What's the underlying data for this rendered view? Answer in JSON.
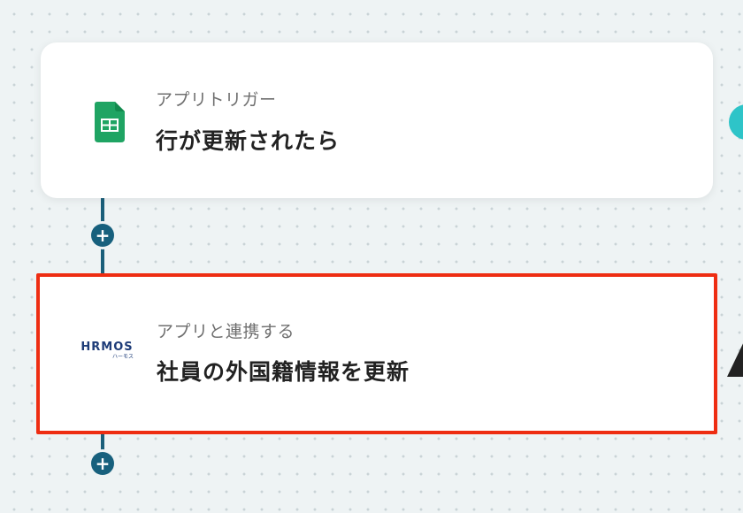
{
  "flow": {
    "trigger": {
      "category": "アプリトリガー",
      "name": "行が更新されたら",
      "app_icon": "google-sheets-icon"
    },
    "action": {
      "category": "アプリと連携する",
      "name": "社員の外国籍情報を更新",
      "app_logo": "HRMOS",
      "app_logo_sub": "ハーモス"
    },
    "add_step_label": "+"
  },
  "colors": {
    "connector": "#1b5f7a",
    "highlight_border": "#ee2d12",
    "sheets_green": "#1fa463"
  }
}
